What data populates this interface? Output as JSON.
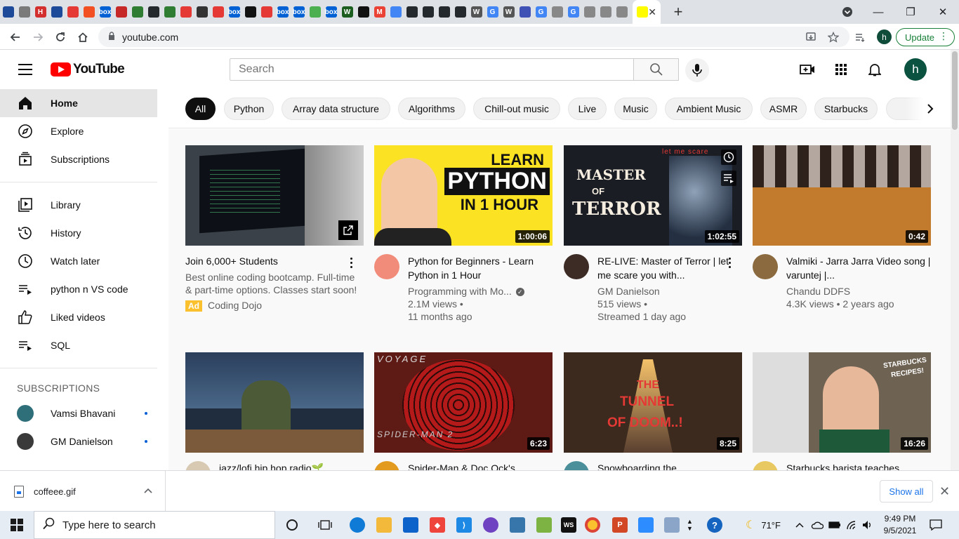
{
  "browser": {
    "tab_favicons": [
      {
        "name": "tab-favicon-1",
        "color": "#1e4a9a",
        "glyph": ""
      },
      {
        "name": "tab-favicon-2",
        "color": "#7a7a7a",
        "glyph": ""
      },
      {
        "name": "tab-favicon-3",
        "color": "#d32f2f",
        "glyph": "H"
      },
      {
        "name": "tab-favicon-4",
        "color": "#1e4a9a",
        "glyph": ""
      },
      {
        "name": "tab-favicon-5",
        "color": "#e53935",
        "glyph": ""
      },
      {
        "name": "tab-favicon-6",
        "color": "#f25022",
        "glyph": ""
      },
      {
        "name": "tab-favicon-7",
        "color": "#0061d5",
        "glyph": "box"
      },
      {
        "name": "tab-favicon-8",
        "color": "#c62828",
        "glyph": ""
      },
      {
        "name": "tab-favicon-9",
        "color": "#2e7d32",
        "glyph": ""
      },
      {
        "name": "tab-favicon-10",
        "color": "#24292e",
        "glyph": ""
      },
      {
        "name": "tab-favicon-11",
        "color": "#2e7d32",
        "glyph": ""
      },
      {
        "name": "tab-favicon-12",
        "color": "#e53935",
        "glyph": ""
      },
      {
        "name": "tab-favicon-13",
        "color": "#333333",
        "glyph": ""
      },
      {
        "name": "tab-favicon-14",
        "color": "#e53935",
        "glyph": ""
      },
      {
        "name": "tab-favicon-15",
        "color": "#0061d5",
        "glyph": "box"
      },
      {
        "name": "tab-favicon-16",
        "color": "#111111",
        "glyph": ""
      },
      {
        "name": "tab-favicon-17",
        "color": "#e53935",
        "glyph": ""
      },
      {
        "name": "tab-favicon-18",
        "color": "#0061d5",
        "glyph": "box"
      },
      {
        "name": "tab-favicon-19",
        "color": "#0061d5",
        "glyph": "box"
      },
      {
        "name": "tab-favicon-20",
        "color": "#4caf50",
        "glyph": ""
      },
      {
        "name": "tab-favicon-21",
        "color": "#0061d5",
        "glyph": "box"
      },
      {
        "name": "tab-favicon-22",
        "color": "#1b5e20",
        "glyph": "W"
      },
      {
        "name": "tab-favicon-23",
        "color": "#111111",
        "glyph": ""
      },
      {
        "name": "tab-favicon-24",
        "color": "#ea4335",
        "glyph": "M"
      },
      {
        "name": "tab-favicon-25",
        "color": "#4285f4",
        "glyph": ""
      },
      {
        "name": "tab-favicon-26",
        "color": "#24292e",
        "glyph": ""
      },
      {
        "name": "tab-favicon-27",
        "color": "#24292e",
        "glyph": ""
      },
      {
        "name": "tab-favicon-28",
        "color": "#24292e",
        "glyph": ""
      },
      {
        "name": "tab-favicon-29",
        "color": "#24292e",
        "glyph": ""
      },
      {
        "name": "tab-favicon-30",
        "color": "#555555",
        "glyph": "W"
      },
      {
        "name": "tab-favicon-31",
        "color": "#4285f4",
        "glyph": "G"
      },
      {
        "name": "tab-favicon-32",
        "color": "#555555",
        "glyph": "W"
      },
      {
        "name": "tab-favicon-33",
        "color": "#3f51b5",
        "glyph": ""
      },
      {
        "name": "tab-favicon-34",
        "color": "#4285f4",
        "glyph": "G"
      },
      {
        "name": "tab-favicon-35",
        "color": "#888888",
        "glyph": ""
      },
      {
        "name": "tab-favicon-36",
        "color": "#4285f4",
        "glyph": "G"
      },
      {
        "name": "tab-favicon-37",
        "color": "#888888",
        "glyph": ""
      },
      {
        "name": "tab-favicon-38",
        "color": "#888888",
        "glyph": ""
      },
      {
        "name": "tab-favicon-39",
        "color": "#888888",
        "glyph": ""
      }
    ],
    "url": "youtube.com",
    "profile_initial": "h",
    "update_label": "Update"
  },
  "masthead": {
    "logo_text": "YouTube",
    "search_placeholder": "Search",
    "avatar_initial": "h"
  },
  "sidebar": {
    "primary": [
      {
        "label": "Home",
        "icon": "home-icon",
        "active": true
      },
      {
        "label": "Explore",
        "icon": "compass-icon"
      },
      {
        "label": "Subscriptions",
        "icon": "subscriptions-icon"
      }
    ],
    "library": [
      {
        "label": "Library",
        "icon": "library-icon"
      },
      {
        "label": "History",
        "icon": "history-icon"
      },
      {
        "label": "Watch later",
        "icon": "clock-icon"
      },
      {
        "label": "python n VS code",
        "icon": "playlist-icon"
      },
      {
        "label": "Liked videos",
        "icon": "thumbs-up-icon"
      },
      {
        "label": "SQL",
        "icon": "playlist-icon"
      }
    ],
    "subscriptions_heading": "SUBSCRIPTIONS",
    "subscriptions": [
      {
        "label": "Vamsi Bhavani",
        "color": "#2f6f7a"
      },
      {
        "label": "GM Danielson",
        "color": "#3a3a3a"
      }
    ]
  },
  "chips": [
    "All",
    "Python",
    "Array data structure",
    "Algorithms",
    "Chill-out music",
    "Live",
    "Music",
    "Ambient Music",
    "ASMR",
    "Starbucks"
  ],
  "videos": [
    {
      "title": "Join 6,000+ Students",
      "line1": "Best online coding bootcamp. Full-time & part-time options. Classes start soon!",
      "ad_label": "Ad",
      "channel": "Coding Dojo",
      "duration": "",
      "thumb": "#3b4148"
    },
    {
      "title": "Python for Beginners - Learn Python in 1 Hour",
      "channel": "Programming with Mo...",
      "views": "2.1M views •",
      "age": "11 months ago",
      "duration": "1:00:06",
      "thumb": "#fbe324",
      "thumb_text_1": "LEARN",
      "thumb_text_2": "PYTHON",
      "thumb_text_3": "IN 1 HOUR"
    },
    {
      "title": "RE-LIVE: Master of Terror | let me scare you with...",
      "channel": "GM Danielson",
      "views": "515 views •",
      "age": "Streamed 1 day ago",
      "duration": "1:02:55",
      "thumb": "#1b1d24",
      "thumb_text_1": "MASTER",
      "thumb_text_2": "OF",
      "thumb_text_3": "TERROR",
      "thumb_text_4": "let me scare"
    },
    {
      "title": "Valmiki - Jarra Jarra Video song | varuntej |...",
      "channel": "Chandu DDFS",
      "views": "4.3K views • 2 years ago",
      "age": "",
      "duration": "0:42",
      "thumb": "#5a3d2b"
    },
    {
      "title": "jazz/lofi hip hop radio🌱",
      "duration": "",
      "thumb": "#1f2d3e"
    },
    {
      "title": "Spider-Man & Doc Ock's",
      "duration": "6:23",
      "thumb": "#5e1a14",
      "thumb_text_1": "VOYAGE",
      "thumb_text_2": "SPIDER-MAN 2"
    },
    {
      "title": "Snowboarding the",
      "duration": "8:25",
      "thumb": "#3b2a1d",
      "thumb_text_1": "THE",
      "thumb_text_2": "TUNNEL",
      "thumb_text_3": "OF DOOM..!"
    },
    {
      "title": "Starbucks barista teaches",
      "duration": "16:26",
      "thumb": "#6e6253",
      "thumb_text_1": "STARBUCKS",
      "thumb_text_2": "RECIPES!"
    }
  ],
  "downloads": {
    "file_name": "coffeee.gif",
    "show_all": "Show all"
  },
  "taskbar": {
    "search_placeholder": "Type here to search",
    "weather": "71°F",
    "time": "9:49 PM",
    "date": "9/5/2021"
  }
}
